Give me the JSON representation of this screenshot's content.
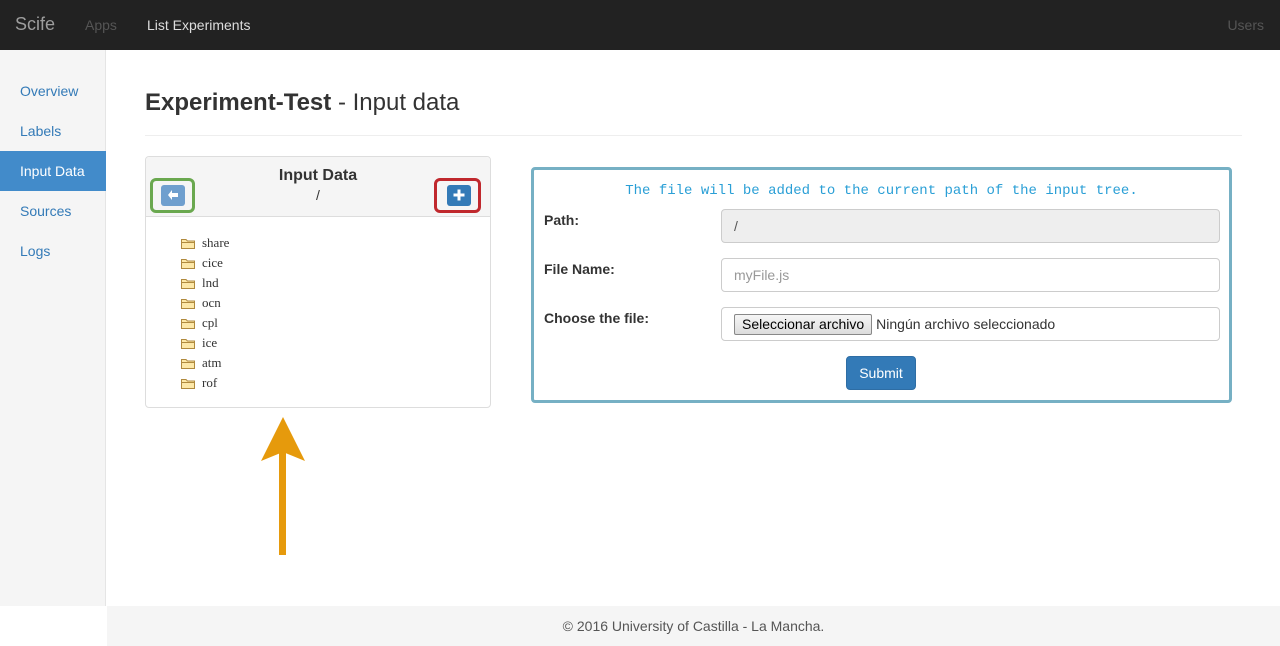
{
  "navbar": {
    "brand": "Scife",
    "apps": "Apps",
    "list_experiments": "List Experiments",
    "users": "Users"
  },
  "sidebar": {
    "items": [
      {
        "label": "Overview",
        "active": false
      },
      {
        "label": "Labels",
        "active": false
      },
      {
        "label": "Input Data",
        "active": true
      },
      {
        "label": "Sources",
        "active": false
      },
      {
        "label": "Logs",
        "active": false
      }
    ]
  },
  "header": {
    "experiment": "Experiment-Test",
    "section": " - Input data"
  },
  "tree": {
    "title": "Input Data",
    "path": "/",
    "back_icon": "arrow-left-icon",
    "add_icon": "plus-icon",
    "items": [
      "share",
      "cice",
      "lnd",
      "ocn",
      "cpl",
      "ice",
      "atm",
      "rof"
    ]
  },
  "form": {
    "note": "The file will be added to the current path of the input tree.",
    "path_label": "Path:",
    "path_value": "/",
    "filename_label": "File Name:",
    "filename_placeholder": "myFile.js",
    "choose_label": "Choose the file:",
    "file_button": "Seleccionar archivo",
    "file_status": "Ningún archivo seleccionado",
    "submit": "Submit"
  },
  "footer": {
    "text": "© 2016 University of Castilla - La Mancha."
  },
  "colors": {
    "navbar": "#222222",
    "primary": "#337ab7",
    "sidebar_active": "#428bca",
    "form_border": "#76b0c4",
    "highlight_green": "#6aa84f",
    "highlight_red": "#c0282d",
    "arrow": "#e69a0c"
  }
}
